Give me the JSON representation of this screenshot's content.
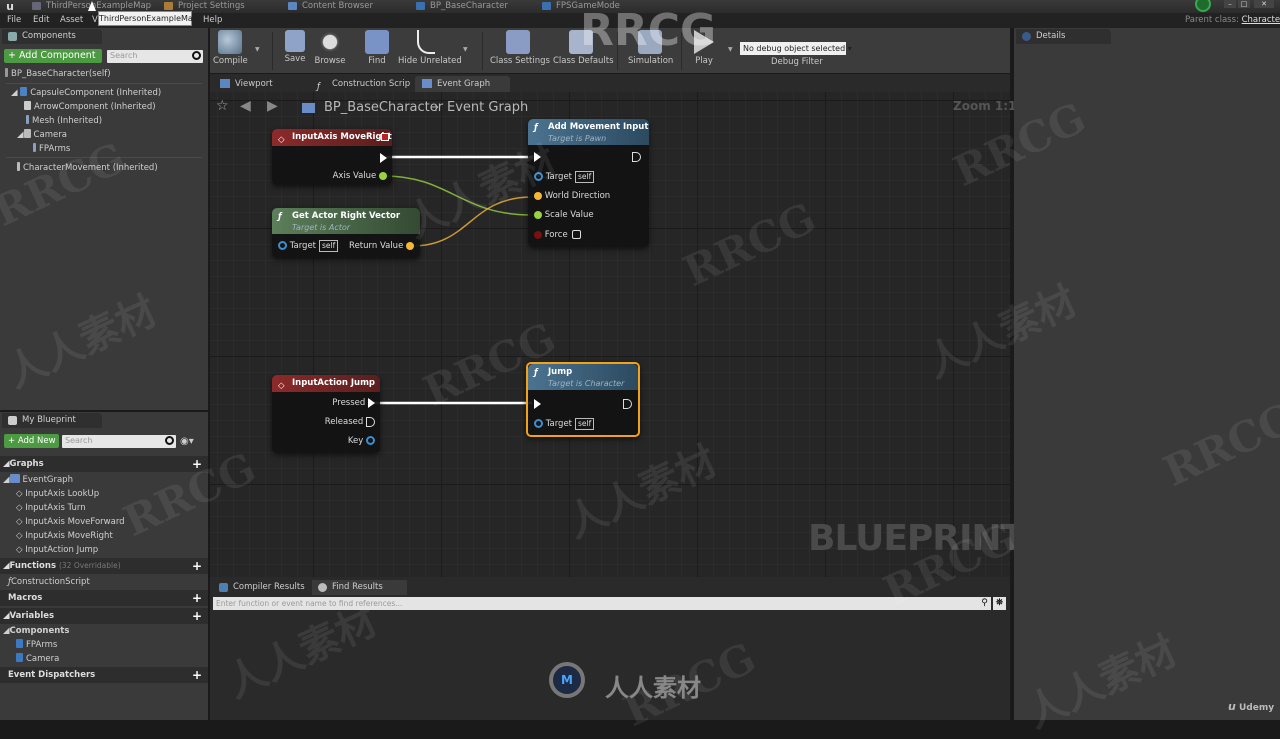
{
  "title_bar": {
    "tabs": [
      {
        "label": "ThirdPersonExampleMap",
        "icon": "level-icon"
      },
      {
        "label": "Project Settings",
        "icon": "settings-icon"
      },
      {
        "label": "Content Browser",
        "icon": "content-browser-icon"
      },
      {
        "label": "BP_BaseCharacter",
        "icon": "blueprint-icon"
      },
      {
        "label": "FPSGameMode",
        "icon": "blueprint-icon"
      }
    ],
    "tooltip": "ThirdPersonExampleMap",
    "window_controls": [
      "minimize",
      "maximize",
      "close"
    ]
  },
  "menu": {
    "items": [
      "File",
      "Edit",
      "Asset",
      "V",
      "Help"
    ],
    "parent_class_label": "Parent class:",
    "parent_class_value": "Character"
  },
  "components_panel": {
    "tab_label": "Components",
    "add_button": "+ Add Component",
    "search_placeholder": "Search",
    "root": "BP_BaseCharacter(self)",
    "items": [
      {
        "label": "CapsuleComponent (Inherited)",
        "level": 1,
        "expanded": true,
        "icon": "capsule-icon"
      },
      {
        "label": "ArrowComponent (Inherited)",
        "level": 2,
        "icon": "arrow-icon"
      },
      {
        "label": "Mesh (Inherited)",
        "level": 2,
        "icon": "mesh-icon"
      },
      {
        "label": "Camera",
        "level": 2,
        "expanded": true,
        "icon": "camera-icon"
      },
      {
        "label": "FPArms",
        "level": 3,
        "icon": "mesh-icon"
      },
      {
        "label": "CharacterMovement (Inherited)",
        "level": 0,
        "icon": "movement-icon"
      }
    ]
  },
  "my_blueprint": {
    "tab_label": "My Blueprint",
    "add_button": "+ Add New",
    "search_placeholder": "Search",
    "graphs_label": "Graphs",
    "event_graph": "EventGraph",
    "events": [
      "InputAxis LookUp",
      "InputAxis Turn",
      "InputAxis MoveForward",
      "InputAxis MoveRight",
      "InputAction Jump"
    ],
    "functions_label": "Functions",
    "functions_count": "(32 Overridable)",
    "functions": [
      "ConstructionScript"
    ],
    "macros_label": "Macros",
    "variables_label": "Variables",
    "components_label": "Components",
    "components": [
      "FPArms",
      "Camera"
    ],
    "dispatchers_label": "Event Dispatchers"
  },
  "toolbar": {
    "buttons": [
      {
        "label": "Compile",
        "icon": "compile-icon"
      },
      {
        "label": "Save",
        "icon": "save-icon"
      },
      {
        "label": "Browse",
        "icon": "browse-icon"
      },
      {
        "label": "Find",
        "icon": "find-icon"
      },
      {
        "label": "Hide Unrelated",
        "icon": "hide-unrelated-icon"
      },
      {
        "label": "Class Settings",
        "icon": "class-settings-icon"
      },
      {
        "label": "Class Defaults",
        "icon": "class-defaults-icon"
      },
      {
        "label": "Simulation",
        "icon": "simulation-icon"
      },
      {
        "label": "Play",
        "icon": "play-icon"
      }
    ],
    "debug_select": "No debug object selected",
    "debug_label": "Debug Filter"
  },
  "graph_tabs": [
    {
      "label": "Viewport",
      "active": false
    },
    {
      "label": "Construction Scrip",
      "active": false
    },
    {
      "label": "Event Graph",
      "active": true
    }
  ],
  "graph": {
    "breadcrumb": [
      "BP_BaseCharacter",
      "Event Graph"
    ],
    "zoom": "Zoom 1:1",
    "watermark": "BLUEPRINT",
    "nodes": {
      "moveright": {
        "title": "InputAxis MoveRight",
        "pins": {
          "axis": "Axis Value"
        }
      },
      "getright": {
        "title": "Get Actor Right Vector",
        "subtitle": "Target is Actor",
        "target": "Target",
        "self": "self",
        "return": "Return Value"
      },
      "addmove": {
        "title": "Add Movement Input",
        "subtitle": "Target is Pawn",
        "target": "Target",
        "self": "self",
        "world_dir": "World Direction",
        "scale": "Scale Value",
        "force": "Force"
      },
      "jumpaction": {
        "title": "InputAction Jump",
        "pressed": "Pressed",
        "released": "Released",
        "key": "Key"
      },
      "jump": {
        "title": "Jump",
        "subtitle": "Target is Character",
        "target": "Target",
        "self": "self"
      }
    }
  },
  "bottom_panel": {
    "tabs": [
      "Compiler Results",
      "Find Results"
    ],
    "find_placeholder": "Enter function or event name to find references..."
  },
  "details_panel": {
    "tab_label": "Details"
  },
  "watermarks": {
    "brand": "人人素材",
    "logo": "M",
    "site": "Udemy",
    "rrcg": "RRCG",
    "cn": "人人素材"
  },
  "colors": {
    "event_header": "#8c2a2a",
    "function_header": "#4b7390",
    "pure_header": "#5c7f5a",
    "float_pin": "#9ad23f",
    "vector_pin": "#f3b73a",
    "object_pin": "#3b8fd1",
    "selection": "#f0a21a",
    "add_button": "#4c9a42"
  }
}
